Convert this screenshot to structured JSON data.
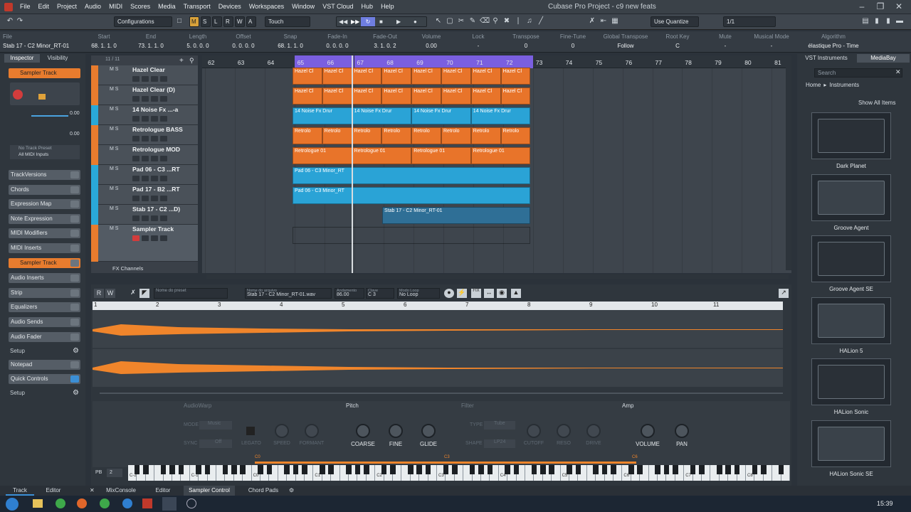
{
  "menubar": {
    "items": [
      "File",
      "Edit",
      "Project",
      "Audio",
      "MIDI",
      "Scores",
      "Media",
      "Transport",
      "Devices",
      "Workspaces",
      "Window",
      "VST Cloud",
      "Hub",
      "Help"
    ],
    "title": "Cubase Pro Project - c9 new feats"
  },
  "toolbar": {
    "configurations": "Configurations",
    "mode": "Touch",
    "quantize": "Use Quantize",
    "quantize_value": "1/1",
    "stepper": [
      "M",
      "S",
      "L",
      "R",
      "W",
      "A"
    ]
  },
  "infoline": {
    "name": "Stab 17 - C2 Minor_RT-01",
    "fields": [
      {
        "h": "File",
        "v": ""
      },
      {
        "h": "Start",
        "v": "68. 1. 1. 0"
      },
      {
        "h": "End",
        "v": "73. 1. 1. 0"
      },
      {
        "h": "Length",
        "v": "5. 0. 0. 0"
      },
      {
        "h": "Offset",
        "v": "0. 0. 0. 0"
      },
      {
        "h": "Snap",
        "v": "68. 1. 1. 0"
      },
      {
        "h": "Fade-In",
        "v": "0. 0. 0. 0"
      },
      {
        "h": "Fade-Out",
        "v": "3. 1. 0. 2"
      },
      {
        "h": "Volume",
        "v": "0.00"
      },
      {
        "h": "Lock",
        "v": "-"
      },
      {
        "h": "Transpose",
        "v": "0"
      },
      {
        "h": "Fine-Tune",
        "v": "0"
      },
      {
        "h": "Global Transpose",
        "v": "Follow"
      },
      {
        "h": "Root Key",
        "v": "C"
      },
      {
        "h": "Mute",
        "v": "-"
      },
      {
        "h": "Musical Mode",
        "v": "-"
      },
      {
        "h": "Algorithm",
        "v": "élastique Pro - Time"
      }
    ]
  },
  "inspector": {
    "tabs": [
      "Inspector",
      "Visibility"
    ],
    "track": "Sampler Track",
    "preset": "No Track Preset",
    "midi_in": "All MIDI Inputs",
    "vol": "0.00",
    "pan": "0.00",
    "sections": [
      "TrackVersions",
      "Chords",
      "Expression Map",
      "Note Expression",
      "MIDI Modifiers",
      "MIDI Inserts",
      "Sampler Track",
      "Audio Inserts",
      "Strip",
      "Equalizers",
      "Audio Sends",
      "Audio Fader",
      "Setup",
      "Notepad",
      "Quick Controls",
      "Setup"
    ]
  },
  "tracklist": {
    "count": "11 / 11",
    "fx": "FX Channels",
    "tracks": [
      {
        "name": "Hazel Clear",
        "color": "#e87c2e"
      },
      {
        "name": "Hazel Clear (D)",
        "color": "#e87c2e"
      },
      {
        "name": "14 Noise Fx ...-a",
        "color": "#2aa8d8"
      },
      {
        "name": "Retrologue BASS",
        "color": "#e87c2e"
      },
      {
        "name": "Retrologue MOD",
        "color": "#e87c2e"
      },
      {
        "name": "Pad 06 - C3 ...RT",
        "color": "#2aa8d8"
      },
      {
        "name": "Pad 17 - B2 ...RT",
        "color": "#2aa8d8"
      },
      {
        "name": "Stab 17 - C2 ...D)",
        "color": "#2aa8d8"
      },
      {
        "name": "Sampler Track",
        "color": "#e87c2e"
      }
    ]
  },
  "ruler": {
    "bars": [
      "62",
      "63",
      "64",
      "65",
      "66",
      "67",
      "68",
      "69",
      "70",
      "71",
      "72",
      "73",
      "74",
      "75",
      "76",
      "77",
      "78",
      "79",
      "80",
      "81"
    ]
  },
  "events": {
    "hazel": "Hazel Cl",
    "noise": "14 Noise Fx Drur",
    "retro": "Retrolo",
    "retro_mod": "Retrologue 01",
    "pad06": "Pad 06 - C3 Minor_RT",
    "pad17": "Pad 06 - C3 Minor_RT",
    "stab": "Stab 17 - C2 Minor_RT-01"
  },
  "sampler_control": {
    "preset_label": "Nome do preset",
    "file_label": "Nome do arquivo",
    "file": "Stab 17 - C2 Minor_RT-01.wav",
    "tempo_label": "Andamento",
    "tempo": "86.00",
    "key_label": "Clave",
    "key": "C 3",
    "loop_label": "Modo Loop",
    "loop": "No Loop",
    "rw": [
      "R",
      "W"
    ],
    "ruler": [
      "1",
      "2",
      "3",
      "4",
      "5",
      "6",
      "7",
      "8",
      "9",
      "10",
      "11"
    ],
    "audiowarp": "AudioWarp",
    "pitch": "Pitch",
    "filter": "Filter",
    "amp": "Amp",
    "aw_labels": [
      "MODE",
      "SYNC",
      "LEGATO",
      "SPEED",
      "FORMANT"
    ],
    "aw_values": [
      "Music",
      "Off"
    ],
    "pitch_knobs": [
      "COARSE",
      "FINE",
      "GLIDE"
    ],
    "filter_labels": [
      "TYPE",
      "SHAPE",
      "CUTOFF",
      "RESO",
      "DRIVE"
    ],
    "filter_values": [
      "Tube",
      "LP24"
    ],
    "amp_knobs": [
      "VOLUME",
      "PAN"
    ],
    "pb": "PB",
    "pb_value": "2",
    "key_marks": [
      "C0",
      "C3",
      "C6"
    ],
    "octaves": [
      "C-2",
      "C-1",
      "C0",
      "C1",
      "C2",
      "C3",
      "C4",
      "C5",
      "C6",
      "C7",
      "C8"
    ]
  },
  "rightzone": {
    "tabs": [
      "VST Instruments",
      "MediaBay"
    ],
    "search": "Search",
    "breadcrumb": [
      "Home",
      "Instruments"
    ],
    "show_all": "Show All Items",
    "plugins": [
      "Dark Planet",
      "Groove Agent",
      "Groove Agent SE",
      "HALion 5",
      "HALion Sonic",
      "HALion Sonic SE"
    ]
  },
  "bottom": {
    "tabs": [
      "Track",
      "Editor",
      "MixConsole",
      "Editor",
      "Sampler Control",
      "Chord Pads"
    ]
  },
  "taskbar": {
    "time": "15:39"
  }
}
